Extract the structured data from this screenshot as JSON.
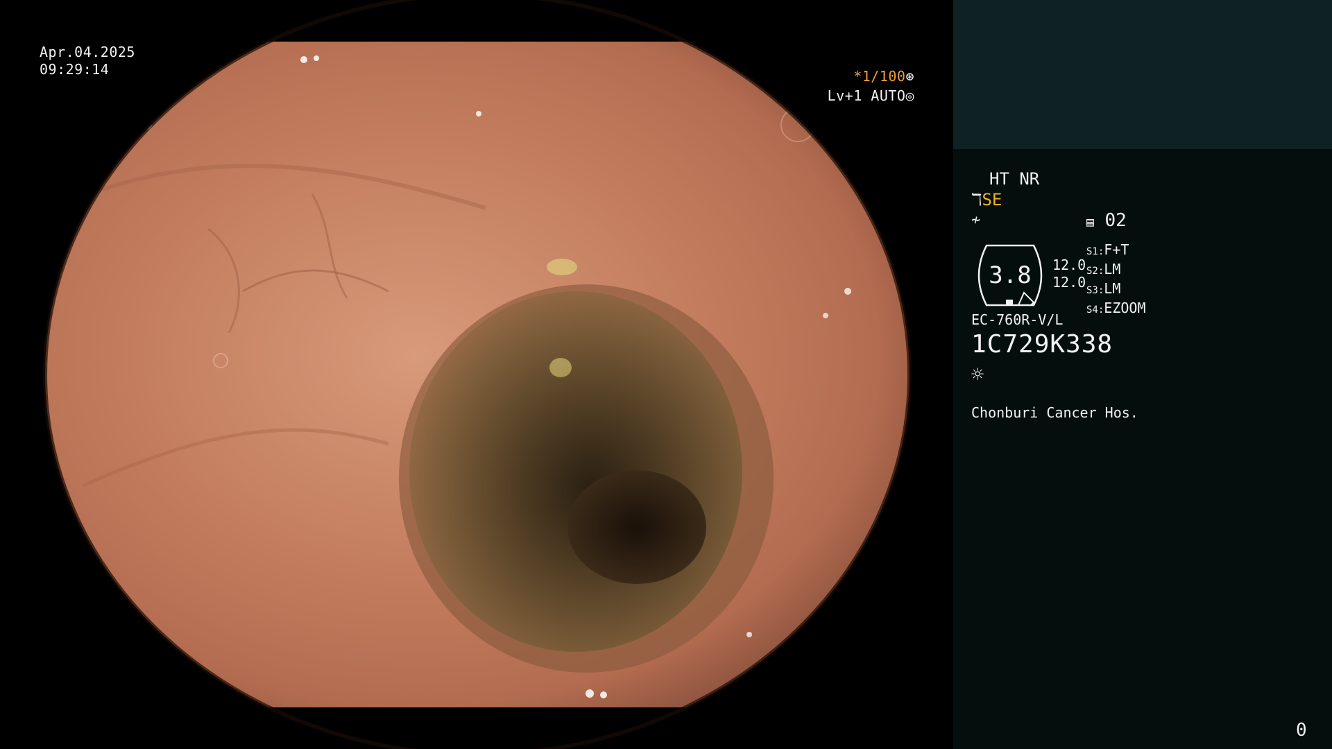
{
  "video": {
    "date": "Apr.04.2025",
    "time": "09:29:14",
    "shutter": "*1/100",
    "shutter_icon": "aperture-icon",
    "level": "Lv+1 AUTO",
    "level_icon": "iris-icon"
  },
  "panel": {
    "mode": "HT NR",
    "enhance_icon": "enhance-icon",
    "enhance": "SE",
    "structure_icon": "structure-icon",
    "memo_icon": "memo-icon",
    "memo_value": "02",
    "gauge_value": "3.8",
    "num1": "12.0",
    "num2": "12.0",
    "s_modes": [
      {
        "key": "S1:",
        "val": "F+T"
      },
      {
        "key": "S2:",
        "val": "LM"
      },
      {
        "key": "S3:",
        "val": "LM"
      },
      {
        "key": "S4:",
        "val": "EZOOM"
      }
    ],
    "model": "EC-760R-V/L",
    "serial": "1C729K338",
    "light_icon": "light-icon",
    "hospital": "Chonburi Cancer Hos.",
    "counter": "0"
  },
  "colors": {
    "panel_bg": "#040f0d",
    "panel_top_bg": "#0e2224",
    "highlight": "#f0b020",
    "shutter": "#f0a030"
  }
}
